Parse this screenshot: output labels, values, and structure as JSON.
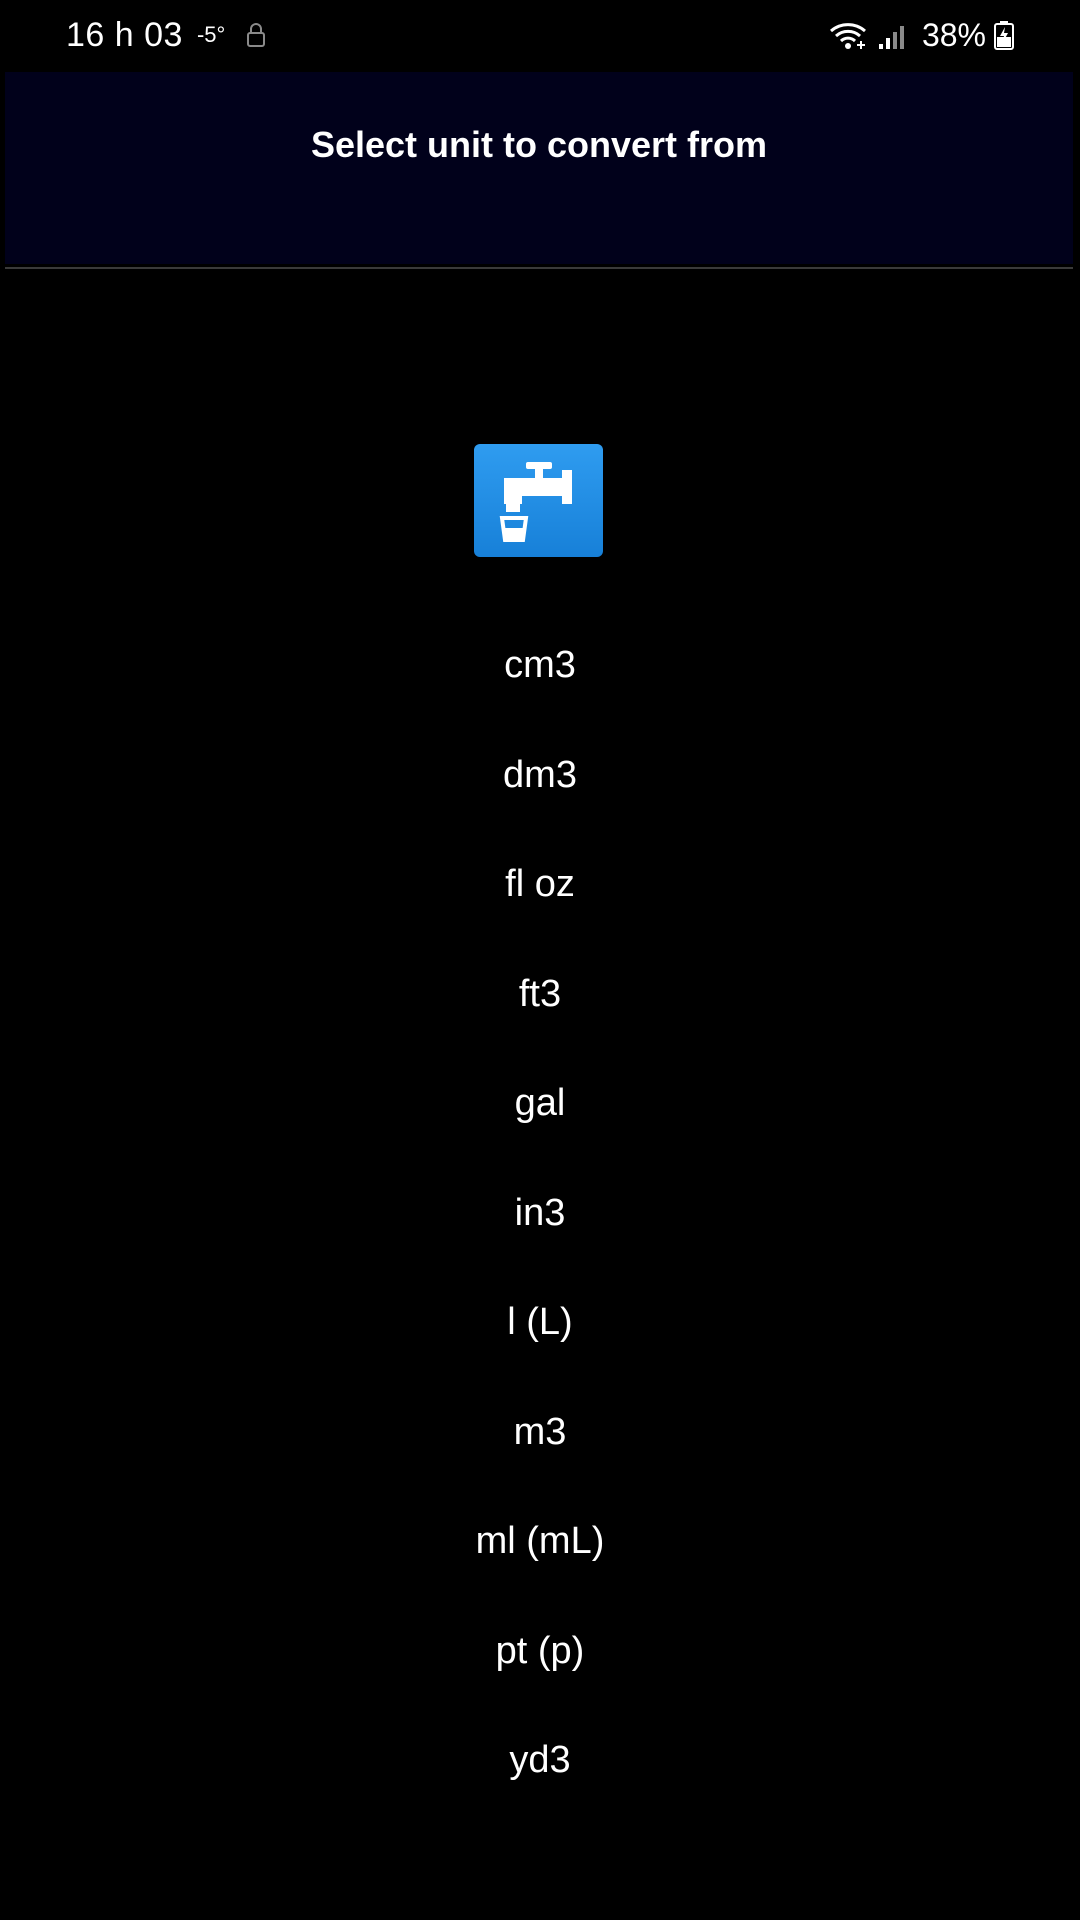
{
  "status_bar": {
    "time": "16 h 03",
    "temperature": "-5°",
    "battery": "38%",
    "icons": [
      "lock-icon",
      "wifi-icon",
      "signal-icon",
      "battery-charging-icon"
    ]
  },
  "header": {
    "title": "Select unit to convert from",
    "background": "#01011b"
  },
  "category": {
    "icon": "faucet-glass-icon",
    "color": "#2389e6"
  },
  "units": [
    "cm3",
    "dm3",
    "fl oz",
    "ft3",
    "gal",
    "in3",
    "l (L)",
    "m3",
    "ml (mL)",
    "pt (p)",
    "yd3"
  ]
}
